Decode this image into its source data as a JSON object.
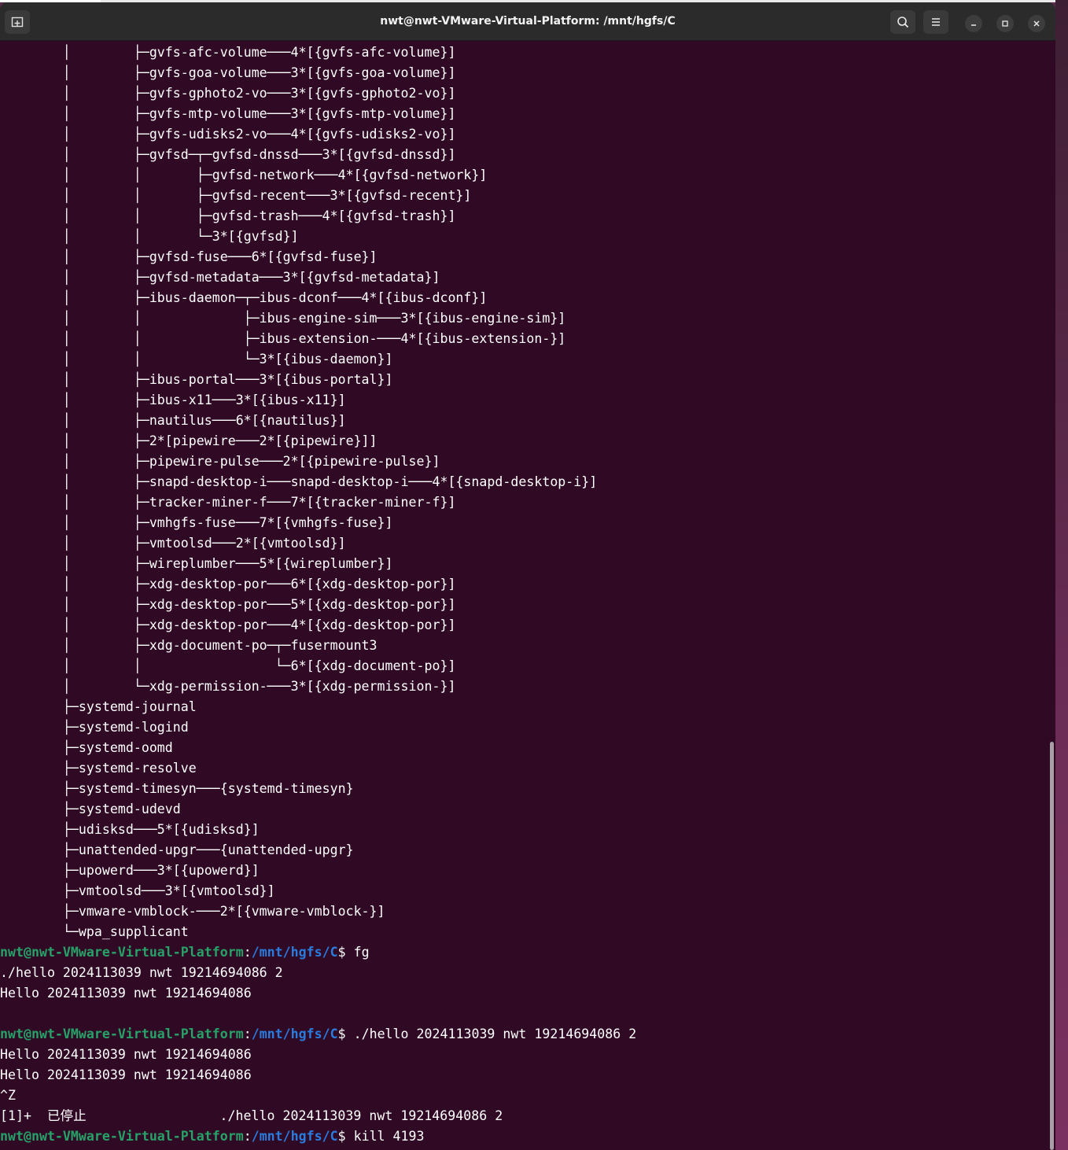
{
  "window": {
    "title": "nwt@nwt-VMware-Virtual-Platform: /mnt/hgfs/C"
  },
  "titlebar": {
    "new_tab_icon": "new-tab-icon",
    "search_icon": "search-icon",
    "menu_icon": "hamburger-menu-icon",
    "minimize_icon": "minimize-icon",
    "maximize_icon": "maximize-icon",
    "close_icon": "close-icon"
  },
  "colors": {
    "terminal_bg": "#300a24",
    "prompt_user": "#26a269",
    "prompt_path": "#2a7bde",
    "text": "#ffffff"
  },
  "terminal": {
    "tree_lines": [
      "        │        ├─gvfs-afc-volume───4*[{gvfs-afc-volume}]",
      "        │        ├─gvfs-goa-volume───3*[{gvfs-goa-volume}]",
      "        │        ├─gvfs-gphoto2-vo───3*[{gvfs-gphoto2-vo}]",
      "        │        ├─gvfs-mtp-volume───3*[{gvfs-mtp-volume}]",
      "        │        ├─gvfs-udisks2-vo───4*[{gvfs-udisks2-vo}]",
      "        │        ├─gvfsd─┬─gvfsd-dnssd───3*[{gvfsd-dnssd}]",
      "        │        │       ├─gvfsd-network───4*[{gvfsd-network}]",
      "        │        │       ├─gvfsd-recent───3*[{gvfsd-recent}]",
      "        │        │       ├─gvfsd-trash───4*[{gvfsd-trash}]",
      "        │        │       └─3*[{gvfsd}]",
      "        │        ├─gvfsd-fuse───6*[{gvfsd-fuse}]",
      "        │        ├─gvfsd-metadata───3*[{gvfsd-metadata}]",
      "        │        ├─ibus-daemon─┬─ibus-dconf───4*[{ibus-dconf}]",
      "        │        │             ├─ibus-engine-sim───3*[{ibus-engine-sim}]",
      "        │        │             ├─ibus-extension-───4*[{ibus-extension-}]",
      "        │        │             └─3*[{ibus-daemon}]",
      "        │        ├─ibus-portal───3*[{ibus-portal}]",
      "        │        ├─ibus-x11───3*[{ibus-x11}]",
      "        │        ├─nautilus───6*[{nautilus}]",
      "        │        ├─2*[pipewire───2*[{pipewire}]]",
      "        │        ├─pipewire-pulse───2*[{pipewire-pulse}]",
      "        │        ├─snapd-desktop-i───snapd-desktop-i───4*[{snapd-desktop-i}]",
      "        │        ├─tracker-miner-f───7*[{tracker-miner-f}]",
      "        │        ├─vmhgfs-fuse───7*[{vmhgfs-fuse}]",
      "        │        ├─vmtoolsd───2*[{vmtoolsd}]",
      "        │        ├─wireplumber───5*[{wireplumber}]",
      "        │        ├─xdg-desktop-por───6*[{xdg-desktop-por}]",
      "        │        ├─xdg-desktop-por───5*[{xdg-desktop-por}]",
      "        │        ├─xdg-desktop-por───4*[{xdg-desktop-por}]",
      "        │        ├─xdg-document-po─┬─fusermount3",
      "        │        │                 └─6*[{xdg-document-po}]",
      "        │        └─xdg-permission-───3*[{xdg-permission-}]",
      "        ├─systemd-journal",
      "        ├─systemd-logind",
      "        ├─systemd-oomd",
      "        ├─systemd-resolve",
      "        ├─systemd-timesyn───{systemd-timesyn}",
      "        ├─systemd-udevd",
      "        ├─udisksd───5*[{udisksd}]",
      "        ├─unattended-upgr───{unattended-upgr}",
      "        ├─upowerd───3*[{upowerd}]",
      "        ├─vmtoolsd───3*[{vmtoolsd}]",
      "        ├─vmware-vmblock-───2*[{vmware-vmblock-}]",
      "        └─wpa_supplicant"
    ],
    "prompt_user": "nwt@nwt-VMware-Virtual-Platform",
    "prompt_colon": ":",
    "prompt_path": "/mnt/hgfs/C",
    "prompt_dollar": "$ ",
    "session": [
      {
        "type": "prompt",
        "cmd": "fg"
      },
      {
        "type": "out",
        "text": "./hello 2024113039 nwt 19214694086 2"
      },
      {
        "type": "out",
        "text": "Hello 2024113039 nwt 19214694086"
      },
      {
        "type": "out",
        "text": ""
      },
      {
        "type": "prompt",
        "cmd": "./hello 2024113039 nwt 19214694086 2"
      },
      {
        "type": "out",
        "text": "Hello 2024113039 nwt 19214694086"
      },
      {
        "type": "out",
        "text": "Hello 2024113039 nwt 19214694086"
      },
      {
        "type": "out",
        "text": "^Z"
      },
      {
        "type": "out",
        "text": "[1]+  已停止                 ./hello 2024113039 nwt 19214694086 2"
      },
      {
        "type": "prompt",
        "cmd": "kill 4193"
      }
    ]
  }
}
